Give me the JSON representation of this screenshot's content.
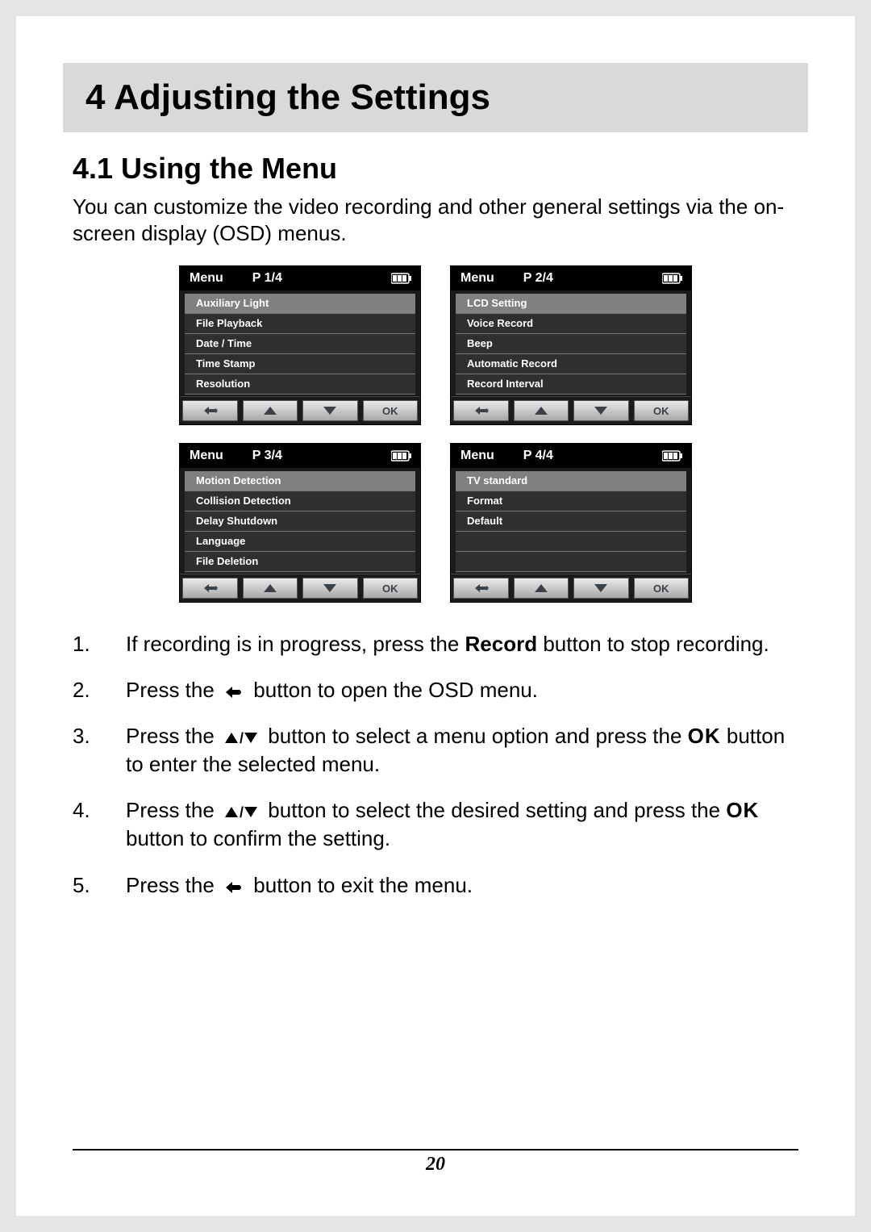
{
  "chapter": {
    "title": "4  Adjusting the Settings"
  },
  "section": {
    "title": "4.1   Using the Menu"
  },
  "intro": "You can customize the video recording and other general settings via the on-screen display (OSD) menus.",
  "menus": [
    {
      "label": "Menu",
      "page": "P 1/4",
      "items": [
        "Auxiliary Light",
        "File Playback",
        "Date / Time",
        "Time Stamp",
        "Resolution"
      ],
      "selected_index": 0,
      "ok": "OK"
    },
    {
      "label": "Menu",
      "page": "P 2/4",
      "items": [
        "LCD Setting",
        "Voice Record",
        "Beep",
        "Automatic Record",
        "Record Interval"
      ],
      "selected_index": 0,
      "ok": "OK"
    },
    {
      "label": "Menu",
      "page": "P 3/4",
      "items": [
        "Motion Detection",
        "Collision Detection",
        "Delay Shutdown",
        "Language",
        "File Deletion"
      ],
      "selected_index": 0,
      "ok": "OK"
    },
    {
      "label": "Menu",
      "page": "P 4/4",
      "items": [
        "TV standard",
        "Format",
        "Default",
        "",
        ""
      ],
      "selected_index": 0,
      "ok": "OK"
    }
  ],
  "steps": [
    {
      "num": "1.",
      "pre": "If recording is in progress, press the ",
      "bold": "Record",
      "post": " button to stop recording."
    },
    {
      "num": "2.",
      "pre": "Press the ",
      "post": " button to open the OSD menu.",
      "icon": "back"
    },
    {
      "num": "3.",
      "pre": "Press the ",
      "mid": " button to select a menu option and press the ",
      "post": " button to enter the selected menu.",
      "icon": "updown",
      "icon2": "ok"
    },
    {
      "num": "4.",
      "pre": "Press the ",
      "mid": " button to select the desired setting and press the ",
      "post": " button to confirm the setting.",
      "icon": "updown",
      "icon2": "ok"
    },
    {
      "num": "5.",
      "pre": "Press the ",
      "post": " button to exit the menu.",
      "icon": "back"
    }
  ],
  "ok_label": "OK",
  "page_number": "20"
}
